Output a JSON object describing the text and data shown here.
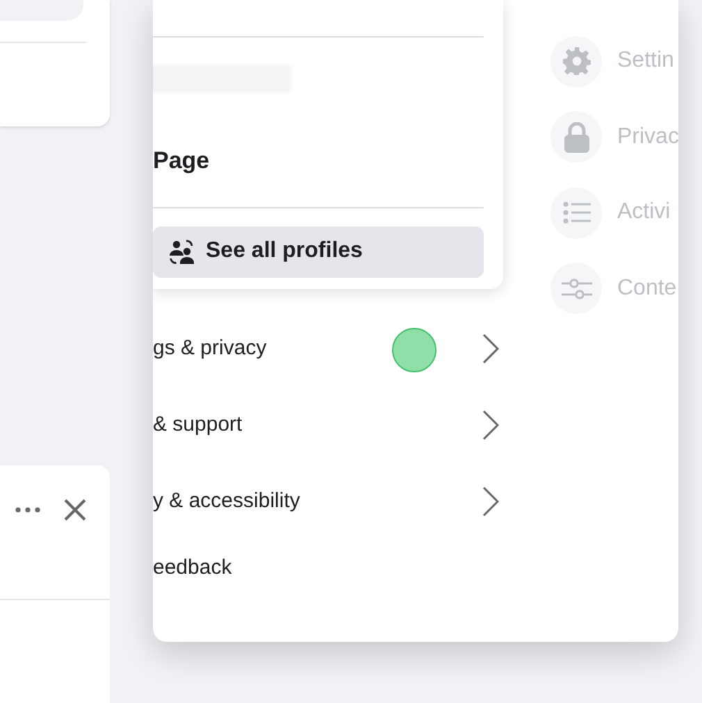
{
  "profile_card": {
    "page_label": "Page",
    "button": "See all profiles"
  },
  "menu": [
    {
      "label": "gs & privacy",
      "chevron": true
    },
    {
      "label": "& support",
      "chevron": true
    },
    {
      "label": "y & accessibility",
      "chevron": true
    },
    {
      "label": "eedback",
      "chevron": false
    }
  ],
  "submenu": [
    {
      "label": "Settin",
      "kind": "gear"
    },
    {
      "label": "Privac",
      "kind": "lock"
    },
    {
      "label": "Activi",
      "kind": "list"
    },
    {
      "label": "Conte",
      "kind": "sliders"
    }
  ]
}
